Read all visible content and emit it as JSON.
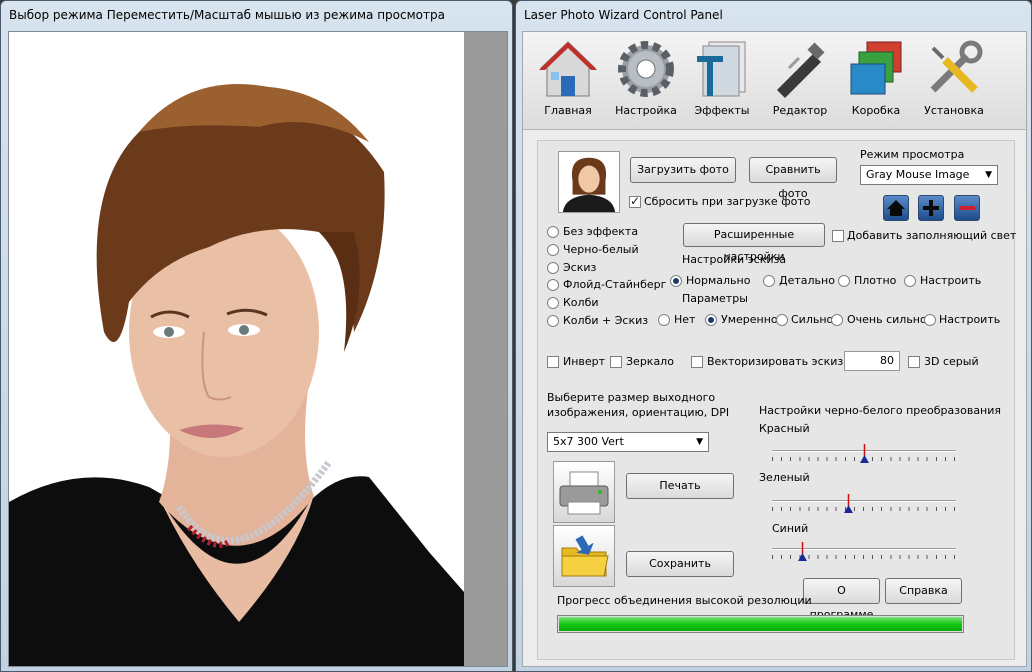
{
  "left_window": {
    "title": "Выбор режима Переместить/Масштаб мышью из режима просмотра"
  },
  "right_window": {
    "title": "Laser Photo Wizard Control Panel",
    "toolbar": [
      {
        "label": "Главная",
        "icon": "home-icon"
      },
      {
        "label": "Настройка",
        "icon": "gear-icon"
      },
      {
        "label": "Эффекты",
        "icon": "effects-icon"
      },
      {
        "label": "Редактор",
        "icon": "airbrush-icon"
      },
      {
        "label": "Коробка",
        "icon": "box-icon"
      },
      {
        "label": "Установка",
        "icon": "tools-icon"
      }
    ],
    "load_photo": "Загрузить фото",
    "compare_photo": "Сравнить фото",
    "view_mode_label": "Режим просмотра",
    "view_mode_value": "Gray Mouse Image",
    "reset_on_load": "Сбросить при загрузке фото",
    "advanced_settings": "Расширенные настройки",
    "add_fill_light": "Добавить заполняющий свет",
    "effects": [
      "Без эффекта",
      "Черно-белый",
      "Эскиз",
      "Флойд-Стайнберг",
      "Колби",
      "Колби + Эскиз"
    ],
    "sketch_settings_label": "Настройки эскиза",
    "sketch_options": [
      "Нормально",
      "Детально",
      "Плотно",
      "Настроить"
    ],
    "params_label": "Параметры",
    "param_options": [
      "Нет",
      "Умеренно",
      "Сильно",
      "Очень сильно",
      "Настроить"
    ],
    "invert": "Инверт",
    "mirror": "Зеркало",
    "vectorize_sketch": "Векторизировать эскиз",
    "vectorize_value": "80",
    "gray_3d": "3D серый",
    "output_size_label_1": "Выберите размер выходного",
    "output_size_label_2": "изображения, ориентацию, DPI",
    "output_size_value": "5x7 300 Vert",
    "print": "Печать",
    "save": "Сохранить",
    "bw_settings_label": "Настройки черно-белого преобразования",
    "red_label": "Красный",
    "green_label": "Зеленый",
    "blue_label": "Синий",
    "red_level": 0.5,
    "green_level": 0.41,
    "blue_level": 0.15,
    "about": "О программе",
    "help": "Справка",
    "progress_label": "Прогресс объединения высокой резолюции",
    "progress_value": 1.0,
    "colors": {
      "progress": "#14c814",
      "accent_blue": "#1e4c8c"
    }
  }
}
